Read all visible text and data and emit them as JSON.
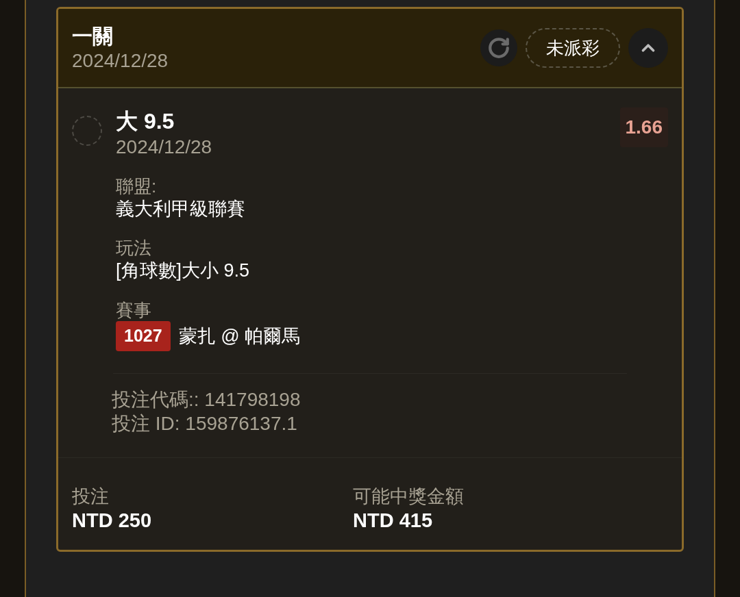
{
  "bet": {
    "title": "一關",
    "date": "2024/12/28",
    "status": "未派彩",
    "expanded": true
  },
  "selection": {
    "selected": false,
    "name": "大 9.5",
    "date": "2024/12/28",
    "odds": "1.66",
    "fields": [
      {
        "label": "聯盟:",
        "value": "義大利甲級聯賽"
      },
      {
        "label": "玩法",
        "value": "[角球數]大小 9.5"
      }
    ],
    "event": {
      "label": "賽事",
      "code": "1027",
      "teams": "蒙扎 @ 帕爾馬"
    },
    "bet_code": "投注代碼:: 141798198",
    "bet_id": "投注 ID: 159876137.1"
  },
  "totals": [
    {
      "label": "投注",
      "value": "NTD 250"
    },
    {
      "label": "可能中獎金額",
      "value": "NTD 415"
    }
  ]
}
